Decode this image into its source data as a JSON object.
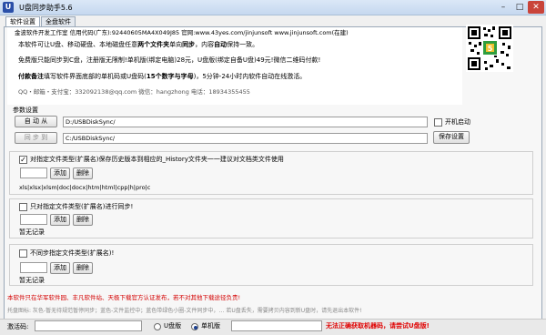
{
  "window": {
    "title": "U盘同步助手5.6"
  },
  "tabs": [
    {
      "label": "软件设置"
    },
    {
      "label": "全盘软件"
    }
  ],
  "info": {
    "company_line": "金波软件开发工作室 信用代码(广东):92440605MA4X049J85 官网:www.43yes.com/jinjunsoft www.jinjunsoft.com(在建)",
    "desc1_pre": "本软件可让U盘、移动硬盘、本地磁盘任意",
    "desc1_bold": "两个文件夹",
    "desc1_mid": "单向",
    "desc1_bold2": "同步",
    "desc1_post": "，内容",
    "desc1_bold3": "自动",
    "desc1_end": "保持一致。",
    "desc2": "免费版只能同步到C盘，注册版无限制!单机版(绑定电脑)28元，U盘版(绑定自备U盘)49元!微信二维码付款!",
    "desc3_bold": "付款备注",
    "desc3_mid": "填写软件界面底部的单机码或U盘码(",
    "desc3_bold2": "15个数字与字母",
    "desc3_end": ")，5分钟-24小时内软件自动在线激活。",
    "contact": "QQ・邮箱・支付宝：332092138@qq.com     微信：hangzhong     电话：18934355455"
  },
  "params": {
    "section_label": "参数设置",
    "auto_button": "自 动 从",
    "sync_button": "同 步 到",
    "source_path": "D:/USBDiskSync/",
    "dest_path": "C:/USBDiskSync/",
    "autostart_label": "开机启动",
    "save_button": "保存设置"
  },
  "rules": [
    {
      "checked": true,
      "label": "对指定文件类型(扩展名)保存历史版本到相应的_History文件夹一一建议对文档类文件使用",
      "list": "xls|xlsx|xlsm|doc|docx|htm|html|cpp|h|pro|c"
    },
    {
      "checked": false,
      "label": "只对指定文件类型(扩展名)进行同步!",
      "list": "暂无记录"
    },
    {
      "checked": false,
      "label": "不同步指定文件类型(扩展名)!",
      "list": "暂无记录"
    }
  ],
  "buttons": {
    "add": "添加",
    "delete": "删除"
  },
  "notice": "本软件只在华军软件园、丰凡软件站、天极下载官方认证发布，若不对其他下载途径负责!",
  "tip": "托盘图标: 灰色-暂无待规范暂停同步；蓝色-文件监控中；蓝色带绿色小圈-文件同步中，…  若U盘丢失，需要拷贝内容到新U盘时，请先退出本软件!",
  "status": {
    "code_label": "激活码:",
    "code_value": "",
    "radio_usb": "U盘版",
    "radio_pc": "单机版",
    "selected": "单机版",
    "warning": "无法正确获取机器码，请尝试U盘版!"
  },
  "colors": {
    "notice": "#d40000",
    "warning": "#e00000",
    "titlebar": "#c5d8ef"
  }
}
